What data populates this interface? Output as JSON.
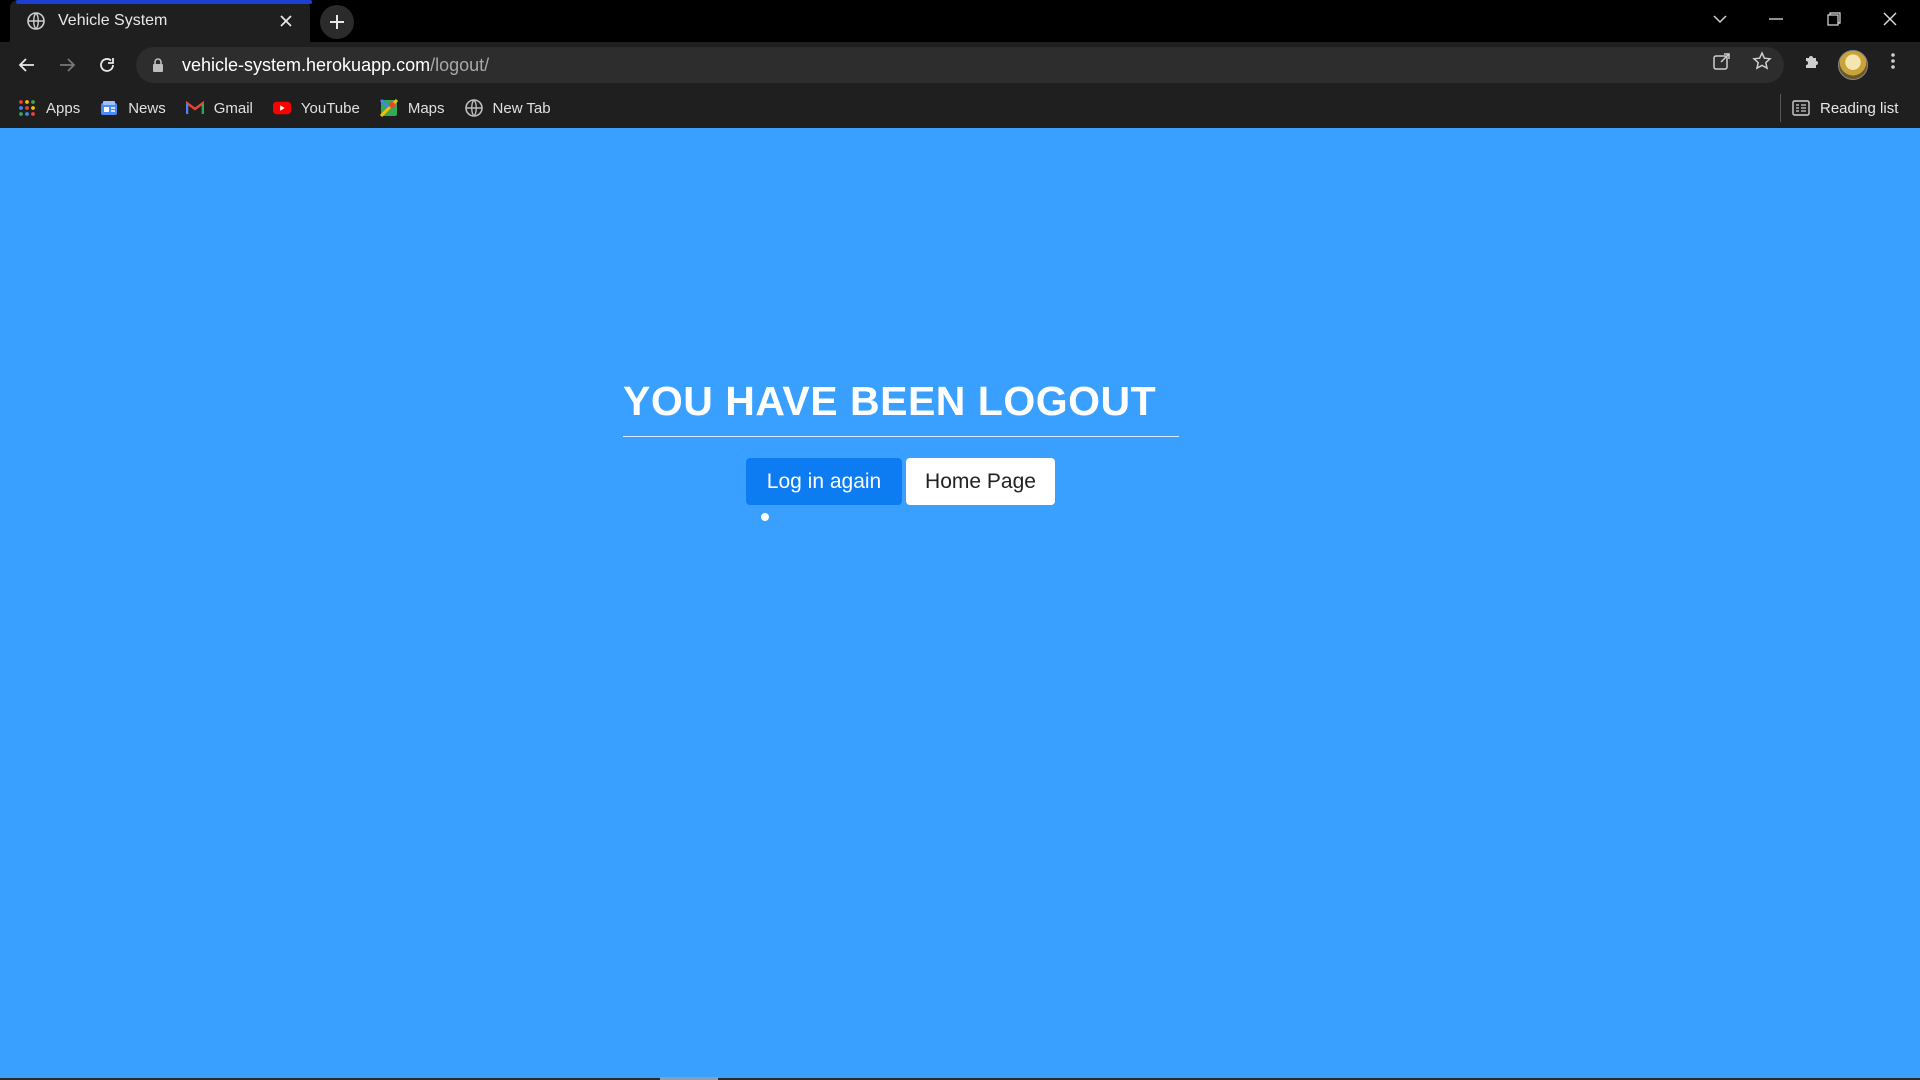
{
  "browser": {
    "tab": {
      "title": "Vehicle System",
      "favicon": "globe-icon"
    },
    "address": {
      "host": "vehicle-system.herokuapp.com",
      "path": "/logout/"
    },
    "bookmarks": [
      {
        "label": "Apps",
        "icon": "apps-grid-icon"
      },
      {
        "label": "News",
        "icon": "news-icon"
      },
      {
        "label": "Gmail",
        "icon": "gmail-icon"
      },
      {
        "label": "YouTube",
        "icon": "youtube-icon"
      },
      {
        "label": "Maps",
        "icon": "maps-icon"
      },
      {
        "label": "New Tab",
        "icon": "globe-icon"
      }
    ],
    "reading_list": "Reading list"
  },
  "page": {
    "heading": "YOU HAVE BEEN LOGOUT",
    "login_again_label": "Log in again",
    "home_page_label": "Home Page"
  },
  "colors": {
    "page_background": "#3aa0ff",
    "primary_button": "#0d7cf2",
    "light_button": "#ffffff"
  }
}
